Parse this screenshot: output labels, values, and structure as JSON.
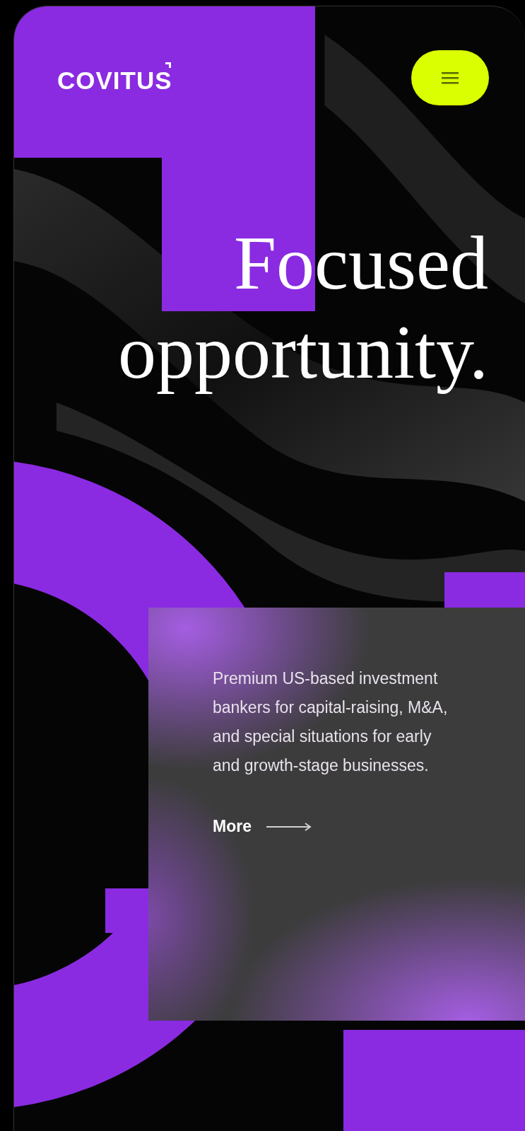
{
  "header": {
    "logo": "COVITUS"
  },
  "hero": {
    "headline_lines": [
      "Focused",
      "opportunity."
    ]
  },
  "card": {
    "text": "Premium US-based investment bankers for capital-raising, M&A, and special situations for early and growth-stage businesses.",
    "link": "More"
  }
}
